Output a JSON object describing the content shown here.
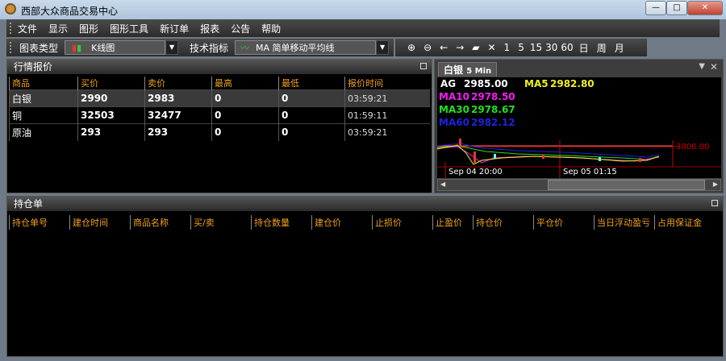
{
  "window": {
    "title": "西部大众商品交易中心"
  },
  "menu": [
    "文件",
    "显示",
    "图形",
    "图形工具",
    "新订单",
    "报表",
    "公告",
    "帮助"
  ],
  "toolbar": {
    "chart_type_label": "图表类型",
    "chart_type_value": "K线图",
    "indicator_label": "技术指标",
    "indicator_value": "MA 简单移动平均线",
    "periods": [
      "1",
      "5",
      "15",
      "30",
      "60",
      "日",
      "周",
      "月"
    ]
  },
  "quotes": {
    "title": "行情报价",
    "columns": [
      "商品",
      "买价",
      "卖价",
      "最高",
      "最低",
      "报价时间"
    ],
    "rows": [
      [
        "白银",
        "2990",
        "2983",
        "0",
        "0",
        "03:59:21"
      ],
      [
        "铜",
        "32503",
        "32477",
        "0",
        "0",
        "01:59:11"
      ],
      [
        "原油",
        "293",
        "293",
        "0",
        "0",
        "03:59:21"
      ]
    ]
  },
  "chart": {
    "tab_name": "白银",
    "tab_period": "5 Min",
    "symbol": "AG",
    "price": "2985.00",
    "ma": [
      {
        "name": "MA5",
        "value": "2982.80",
        "color": "#f0f020"
      },
      {
        "name": "MA10",
        "value": "2978.50",
        "color": "#f020f0"
      },
      {
        "name": "MA30",
        "value": "2978.67",
        "color": "#20e020"
      },
      {
        "name": "MA60",
        "value": "2982.12",
        "color": "#2020e0"
      }
    ],
    "price_label": "3000.00",
    "time_labels": [
      "Sep 04 20:00",
      "Sep 05 01:15"
    ]
  },
  "positions": {
    "title": "持仓单",
    "columns": [
      "持仓单号",
      "建仓时间",
      "商品名称",
      "买/卖",
      "持仓数量",
      "建仓价",
      "止损价",
      "止盈价",
      "持仓价",
      "平仓价",
      "当日浮动盈亏",
      "占用保证金"
    ]
  }
}
